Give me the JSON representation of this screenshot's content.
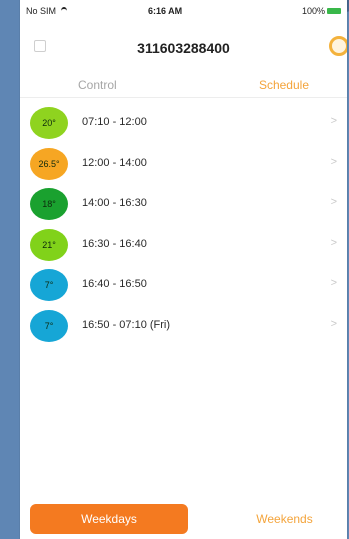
{
  "status_bar": {
    "carrier": "No SIM",
    "time": "6:16 AM",
    "battery": "100%"
  },
  "header": {
    "title": "311603288400"
  },
  "tabs": [
    {
      "label": "Control",
      "active": false
    },
    {
      "label": "Schedule",
      "active": true
    }
  ],
  "schedule": [
    {
      "temp": "20°",
      "range": "07:10 - 12:00",
      "color": "#8fd31f"
    },
    {
      "temp": "26.5°",
      "range": "12:00 - 14:00",
      "color": "#f6a623"
    },
    {
      "temp": "18°",
      "range": "14:00 - 16:30",
      "color": "#1aa12f"
    },
    {
      "temp": "21°",
      "range": "16:30 - 16:40",
      "color": "#81d21a"
    },
    {
      "temp": "7°",
      "range": "16:40 - 16:50",
      "color": "#16a6d6"
    },
    {
      "temp": "7°",
      "range": "16:50 - 07:10 (Fri)",
      "color": "#16a6d6"
    }
  ],
  "bottom_buttons": {
    "weekday": "Weekdays",
    "weekend": "Weekends"
  },
  "colors": {
    "accent": "#f47a20",
    "accent_text": "#f4a43b",
    "background": "#5f86b4"
  }
}
